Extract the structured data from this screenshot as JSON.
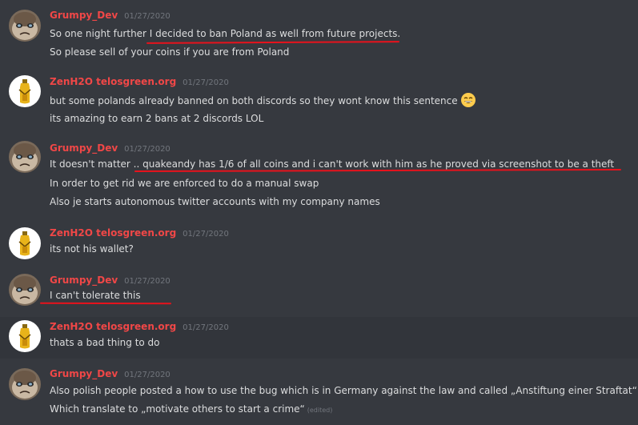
{
  "messages": [
    {
      "author": "Grumpy_Dev",
      "timestamp": "01/27/2020",
      "lines": [
        "So one night further I decided to ban Poland as well from future projects.",
        "So please sell of your coins if you are from Poland"
      ]
    },
    {
      "author": "ZenH2O telosgreen.org",
      "timestamp": "01/27/2020",
      "lines": [
        "but some polands already banned on both discords so they wont know this sentence",
        "its amazing to earn 2 bans at 2 discords LOL"
      ],
      "emoji": "grinning-face-emoji"
    },
    {
      "author": "Grumpy_Dev",
      "timestamp": "01/27/2020",
      "lines": [
        "It doesn't matter .. quakeandy has 1/6 of all coins and i can't work with him as he proved via screenshot to be a theft",
        "In order to get rid we are enforced to do a manual swap",
        "Also je starts autonomous twitter accounts with my company names"
      ]
    },
    {
      "author": "ZenH2O telosgreen.org",
      "timestamp": "01/27/2020",
      "lines": [
        "its not his wallet?"
      ]
    },
    {
      "author": "Grumpy_Dev",
      "timestamp": "01/27/2020",
      "lines": [
        "I can't tolerate this"
      ]
    },
    {
      "author": "ZenH2O telosgreen.org",
      "timestamp": "01/27/2020",
      "lines": [
        "thats a bad thing to do"
      ]
    },
    {
      "author": "Grumpy_Dev",
      "timestamp": "01/27/2020",
      "lines": [
        "Also polish people posted a how to use the bug which is in Germany against the law and called „Anstiftung einer Straftat“",
        "Which translate to „motivate others to start a crime“"
      ],
      "edited_label": "(edited)"
    }
  ],
  "colors": {
    "background": "#36393f",
    "username": "#f04747",
    "text": "#dcddde",
    "timestamp": "#72767d",
    "annotation_underline": "#e8121c"
  }
}
